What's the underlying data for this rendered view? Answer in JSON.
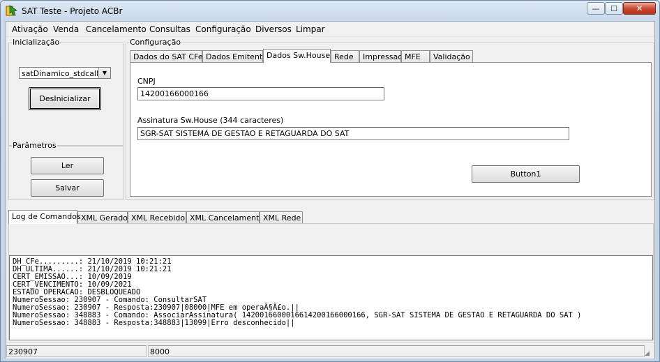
{
  "window": {
    "title": "SAT Teste - Projeto ACBr",
    "minimize": "—",
    "maximize": "☐",
    "close": "✕"
  },
  "menu": [
    "Ativação",
    "Venda",
    "Cancelamento",
    "Consultas",
    "Configuração",
    "Diversos",
    "Limpar"
  ],
  "init": {
    "group_label": "Inicialização",
    "combo_value": "satDinamico_stdcall",
    "deinit_button": "DesInicializar"
  },
  "params": {
    "group_label": "Parâmetros",
    "read_button": "Ler",
    "save_button": "Salvar"
  },
  "config": {
    "group_label": "Configuração",
    "tabs": [
      "Dados do SAT CFe",
      "Dados Emitente",
      "Dados Sw.House",
      "Rede",
      "Impressao",
      "MFE",
      "Validação"
    ],
    "active_tab": "Dados Sw.House",
    "cnpj_label": "CNPJ",
    "cnpj_value": "14200166000166",
    "signature_label": "Assinatura Sw.House (344 caracteres)",
    "signature_value": "SGR-SAT SISTEMA DE GESTAO E RETAGUARDA DO SAT",
    "button1": "Button1"
  },
  "log": {
    "tabs": [
      "Log de Comandos",
      "XML Gerado",
      "XML Recebido",
      "XML Cancelamento",
      "XML Rede"
    ],
    "active_tab": "Log de Comandos",
    "lines": [
      "DH_CFe.........: 21/10/2019 10:21:21",
      "DH_ULTIMA......: 21/10/2019 10:21:21",
      "CERT_EMISSAO...: 10/09/2019",
      "CERT_VENCIMENTO: 10/09/2021",
      "ESTADO_OPERACAO: DESBLOQUEADO",
      "NumeroSessao: 230907 - Comando: ConsultarSAT",
      "NumeroSessao: 230907 - Resposta:230907|08000|MFE em operaÃ§Ã£o.||",
      "NumeroSessao: 348883 - Comando: AssociarAssinatura( 14200166000166142001660001​66, SGR-SAT SISTEMA DE GESTAO E RETAGUARDA DO SAT )",
      "NumeroSessao: 348883 - Resposta:348883|13099|Erro desconhecido||"
    ]
  },
  "status": {
    "session": "230907",
    "code": "8000"
  }
}
